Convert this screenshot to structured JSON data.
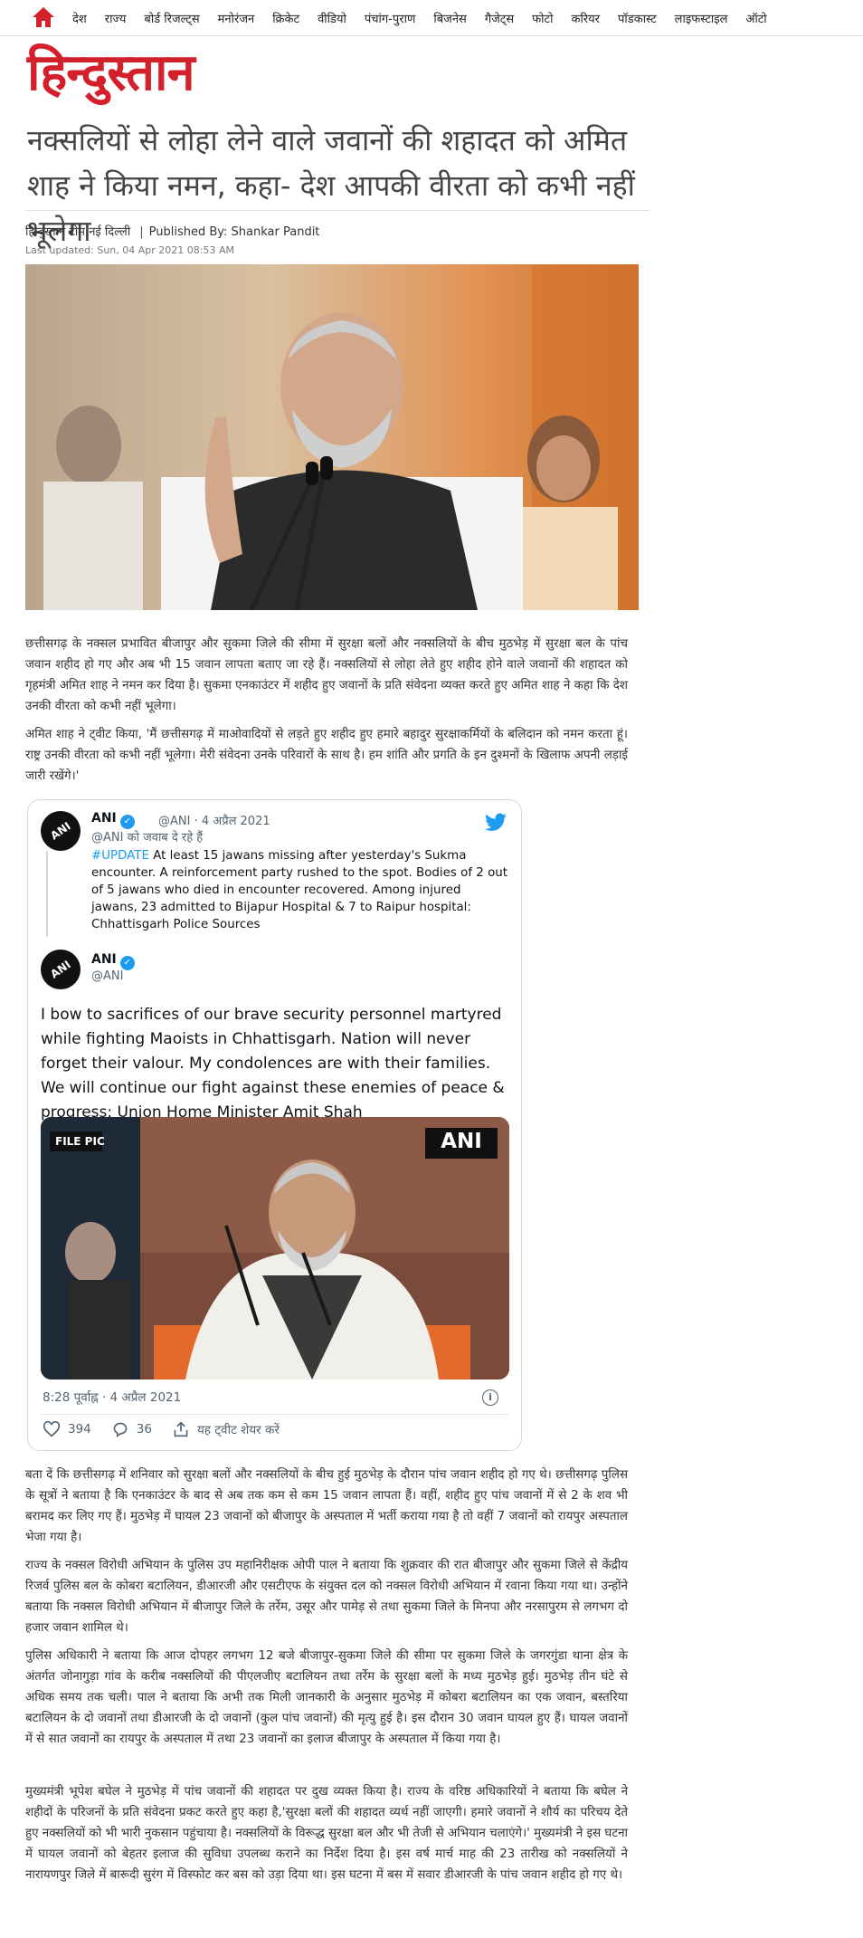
{
  "nav": {
    "items": [
      "देश",
      "राज्य",
      "बोर्ड रिजल्ट्स",
      "मनोरंजन",
      "क्रिकेट",
      "वीडियो",
      "पंचांग-पुराण",
      "बिजनेस",
      "गैजेट्स",
      "फोटो",
      "करियर",
      "पॉडकास्ट",
      "लाइफस्टाइल",
      "ऑटो"
    ]
  },
  "brand": {
    "logo": "हिन्दुस्तान",
    "color": "#d3202a"
  },
  "article": {
    "headline": "नक्सलियों से लोहा लेने वाले जवानों की शहादत को अमित शाह ने किया नमन, कहा- देश आपकी वीरता को कभी नहीं भूलेगा",
    "author": "हिन्दुस्तान टीम,नई दिल्ली",
    "publisher": "Published By: Shankar Pandit",
    "updated": "Last updated: Sun, 04 Apr 2021 08:53 AM",
    "p1": "छत्तीसगढ़ के नक्सल प्रभावित बीजापुर और सुकमा जिले की सीमा में सुरक्षा बलों और नक्सलियों के बीच मुठभेड़ में सुरक्षा बल के पांच जवान शहीद हो गए और अब भी 15 जवान लापता बताए जा रहे हैं। नक्सलियों से लोहा लेते हुए शहीद होने वाले जवानों की शहादत को गृहमंत्री अमित शाह ने नमन कर दिया है। सुकमा एनकाउंटर में शहीद हुए जवानों के प्रति संवेदना व्यक्त करते हुए अमित शाह ने कहा कि देश उनकी वीरता को कभी नहीं भूलेगा।",
    "p2": "अमित शाह ने ट्वीट किया, 'मैं छत्तीसगढ़ में माओवादियों से लड़ते हुए शहीद हुए हमारे बहादुर सुरक्षाकर्मियों के बलिदान को नमन करता हूं। राष्ट्र उनकी वीरता को कभी नहीं भूलेगा। मेरी संवेदना उनके परिवारों के साथ है। हम शांति और प्रगति के इन दुश्मनों के खिलाफ अपनी लड़ाई जारी रखेंगे।'",
    "p3": "बता दें कि छत्तीसगढ़ में शनिवार को सुरक्षा बलों और नक्सलियों के बीच हुई मुठभेड़ के दौरान पांच जवान शहीद हो गए थे। छत्तीसगढ़ पुलिस के सूत्रों ने बताया है कि एनकाउंटर के बाद से अब तक कम से कम 15 जवान लापता हैं। वहीं, शहीद हुए पांच जवानों में से 2 के शव भी बरामद कर लिए गए हैं। मुठभेड़ में घायल 23 जवानों को बीजापुर के अस्पताल में भर्ती कराया गया है तो वहीं 7 जवानों को रायपुर अस्पताल भेजा गया है।",
    "p4": "राज्य के नक्सल विरोधी अभियान के पुलिस उप महानिरीक्षक ओपी पाल ने बताया कि शुक्रवार की रात बीजापुर और सुकमा जिले से केंद्रीय रिजर्व पुलिस बल के कोबरा बटालियन, डीआरजी और एसटीएफ के संयुक्त दल को नक्सल विरोधी अभियान में रवाना किया गया था। उन्होंने बताया कि नक्सल विरोधी अभियान में बीजापुर जिले के तर्रेम, उसूर और पामेड़ से तथा सुकमा जिले के मिनपा और नरसापुरम से लगभग दो हजार जवान शामिल थे।",
    "p5": "पुलिस अधिकारी ने बताया कि आज दोपहर लगभग 12 बजे बीजापुर-सुकमा जिले की सीमा पर सुकमा जिले के जगरगुंडा थाना क्षेत्र के अंतर्गत जोनागुड़ा गांव के करीब नक्सलियों की पीएलजीए बटालियन तथा तर्रेम के सुरक्षा बलों के मध्य मुठभेड़ हुई। मुठभेड़ तीन घंटे से अधिक समय तक चली। पाल ने बताया कि अभी तक मिली जानकारी के अनुसार मुठभेड़ में कोबरा बटालियन का एक जवान, बस्तरिया बटालियन के दो जवानों तथा डीआरजी के दो जवानों (कुल पांच जवानों) की मृत्यु हुई है। इस दौरान 30 जवान घायल हुए हैं। घायल जवानों में से सात जवानों का रायपुर के अस्पताल में तथा 23 जवानों का इलाज बीजापुर के अस्पताल में किया गया है।",
    "p6": "मुख्यमंत्री भूपेश बघेल ने मुठभेड़ में पांच जवानों की शहादत पर दुख व्यक्त किया है। राज्य के वरिष्ठ अधिकारियों ने बताया कि बघेल ने शहीदों के परिजनों के प्रति संवेदना प्रकट करते हुए कहा है,'सुरक्षा बलों की शहादत व्यर्थ नहीं जाएगी। हमारे जवानों ने शौर्य का परिचय देते हुए नक्सलियों को भी भारी नुकसान पहुंचाया है। नक्सलियों के विरूद्ध सुरक्षा बल और भी तेजी से अभियान चलाएंगे।' मुख्यमंत्री ने इस घटना में घायल जवानों को बेहतर इलाज की सुविधा उपलब्ध कराने का निर्देश दिया है। इस वर्ष मार्च माह की 23 तारीख को नक्सलियों ने नारायणपुर जिले में बारूदी सुरंग में विस्फोट कर बस को उड़ा दिया था। इस घटना में बस में सवार डीआरजी के पांच जवान शहीद हो गए थे।"
  },
  "tweet": {
    "quoted": {
      "name": "ANI",
      "handle": "@ANI",
      "date": "4 अप्रैल 2021",
      "reply_to": "@ANI को जवाब दे रहे हैं",
      "hashtag": "#UPDATE",
      "text": " At least 15 jawans missing after yesterday's Sukma encounter. A reinforcement party rushed to the spot. Bodies of 2 out of 5 jawans who died in encounter recovered. Among injured jawans, 23 admitted to Bijapur Hospital & 7 to Raipur hospital: Chhattisgarh Police Sources"
    },
    "main": {
      "name": "ANI",
      "handle": "@ANI",
      "text": "I bow to sacrifices of our brave security personnel martyred while fighting Maoists in Chhattisgarh. Nation will never forget their valour. My condolences are with their families. We will continue our fight against these enemies of peace & progress: Union Home Minister Amit Shah",
      "image_tag_left": "FILE PIC",
      "image_tag_right": "ANI",
      "timestamp": "8:28 पूर्वाह्न · 4 अप्रैल 2021",
      "info": "i",
      "likes": "394",
      "replies": "36",
      "share": "यह ट्वीट शेयर करें"
    }
  }
}
